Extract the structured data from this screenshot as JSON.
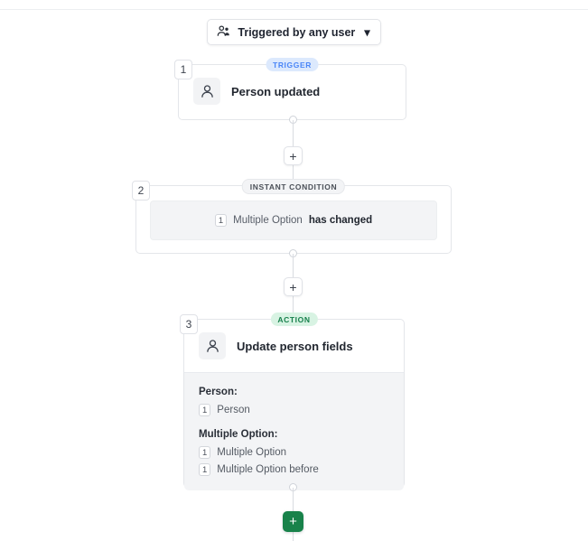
{
  "header": {
    "trigger_select": {
      "icon": "people-icon",
      "label": "Triggered by any user",
      "caret": "▾"
    }
  },
  "steps": [
    {
      "number": "1",
      "type_label": "TRIGGER",
      "icon": "person-icon",
      "title": "Person updated"
    },
    {
      "number": "2",
      "type_label": "INSTANT CONDITION",
      "condition": {
        "chip": "1",
        "subject": "Multiple Option",
        "operator": "has changed"
      }
    },
    {
      "number": "3",
      "type_label": "ACTION",
      "icon": "person-icon",
      "title": "Update person fields",
      "fields": [
        {
          "label": "Person:",
          "values": [
            {
              "chip": "1",
              "text": "Person"
            }
          ]
        },
        {
          "label": "Multiple Option:",
          "values": [
            {
              "chip": "1",
              "text": "Multiple Option"
            },
            {
              "chip": "1",
              "text": "Multiple Option before"
            }
          ]
        }
      ]
    }
  ],
  "connectors": {
    "add_step_glyph": "+",
    "add_final_glyph": "+"
  },
  "colors": {
    "trigger_badge_bg": "#dce9fd",
    "trigger_badge_text": "#4a86f7",
    "action_badge_bg": "#d8f3e3",
    "action_badge_text": "#17804c",
    "condition_badge_bg": "#f3f4f6",
    "add_final_bg": "#18824a",
    "connector_line": "#d9dce1"
  }
}
